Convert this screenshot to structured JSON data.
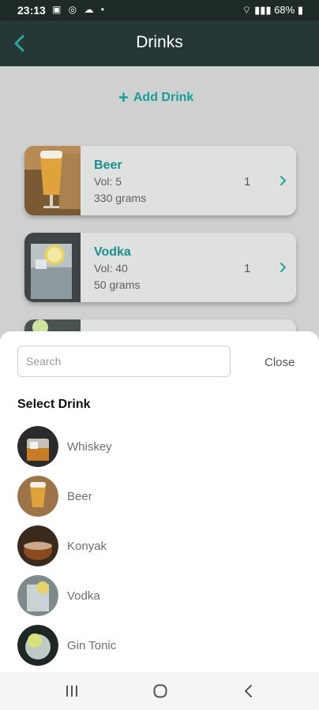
{
  "status_bar": {
    "time": "23:13",
    "battery": "68%"
  },
  "header": {
    "title": "Drinks"
  },
  "add_drink_label": "Add Drink",
  "drinks": [
    {
      "name": "Beer",
      "vol": "Vol: 5",
      "grams": "330 grams",
      "qty": "1"
    },
    {
      "name": "Vodka",
      "vol": "Vol: 40",
      "grams": "50 grams",
      "qty": "1"
    }
  ],
  "sheet": {
    "search_placeholder": "Search",
    "close_label": "Close",
    "title": "Select Drink",
    "items": [
      {
        "label": "Whiskey"
      },
      {
        "label": "Beer"
      },
      {
        "label": "Konyak"
      },
      {
        "label": "Vodka"
      },
      {
        "label": "Gin Tonic"
      }
    ]
  },
  "colors": {
    "accent": "#1a9c9a",
    "header_bg": "#263836",
    "status_bg": "#1d2a28"
  }
}
